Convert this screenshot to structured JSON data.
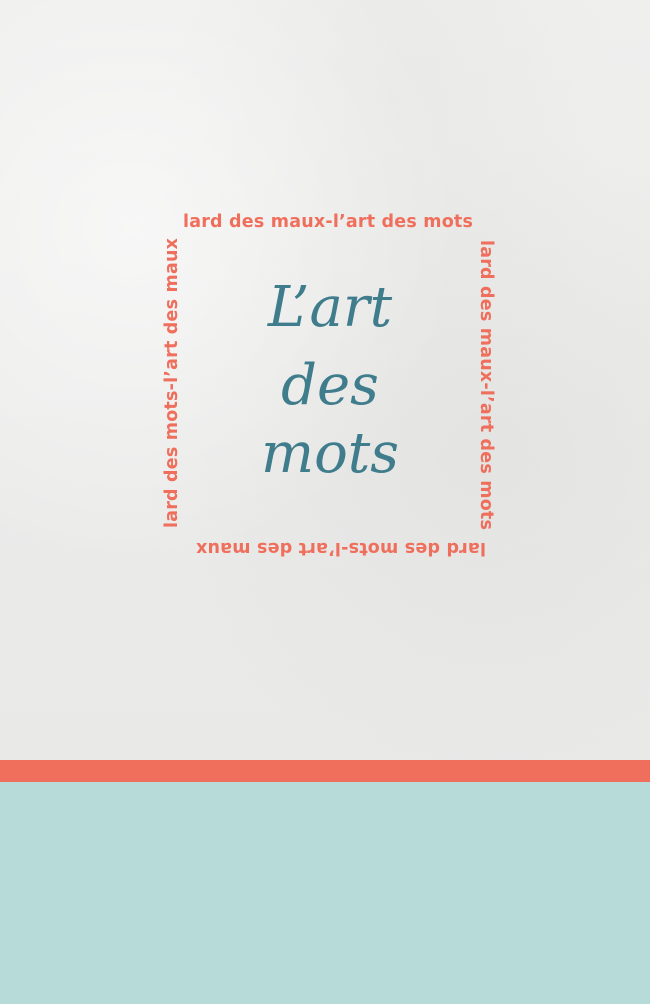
{
  "colors": {
    "background": "#ededec",
    "accent": "#ef6f5c",
    "title": "#3f7c8c",
    "footer": "#b7dbd8"
  },
  "frame": {
    "top": "lard des maux-l’art des mots",
    "right": "lard des maux-l’art des mots",
    "bottom": "lard des mots-l’art des maux",
    "left": "lard des mots-l’art des maux"
  },
  "title": {
    "line1": "L’art",
    "line2": "des",
    "line3": "mots"
  }
}
